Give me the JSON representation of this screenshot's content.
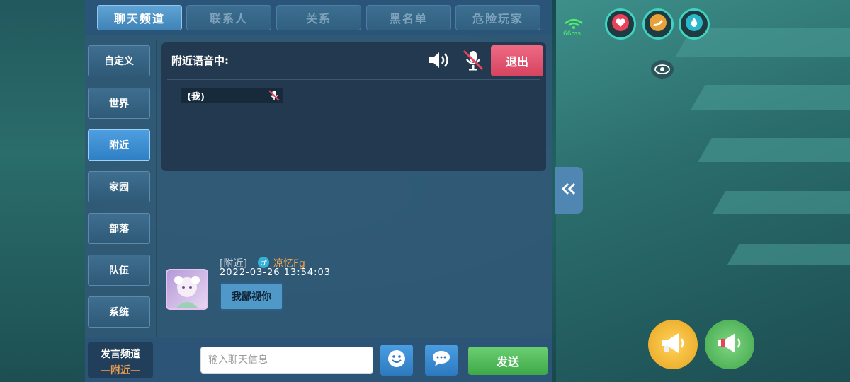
{
  "tabs": [
    {
      "label": "聊天频道",
      "active": true
    },
    {
      "label": "联系人",
      "active": false
    },
    {
      "label": "关系",
      "active": false
    },
    {
      "label": "黑名单",
      "active": false
    },
    {
      "label": "危险玩家",
      "active": false
    }
  ],
  "sidebar": {
    "items": [
      {
        "label": "自定义",
        "active": false
      },
      {
        "label": "世界",
        "active": false
      },
      {
        "label": "附近",
        "active": true
      },
      {
        "label": "家园",
        "active": false
      },
      {
        "label": "部落",
        "active": false
      },
      {
        "label": "队伍",
        "active": false
      },
      {
        "label": "系统",
        "active": false
      }
    ]
  },
  "voice": {
    "title": "附近语音中:",
    "exit_label": "退出",
    "member_label": "(我)"
  },
  "message": {
    "channel_tag": "[附近]",
    "gender_symbol": "♂",
    "sender": "凉忆Fg",
    "timestamp": "2022-03-26   13:54:03",
    "text": "我鄙视你"
  },
  "bottom": {
    "say_channel_label": "发言频道",
    "say_channel_value": "—附近—",
    "input_placeholder": "输入聊天信息",
    "send_label": "发送"
  },
  "hud": {
    "ping": "66ms",
    "stats": [
      "heart-icon",
      "stamina-icon",
      "water-icon"
    ]
  },
  "colors": {
    "active_tab": "#4f98d0",
    "exit_button": "#e05570",
    "send_button": "#4fb85a",
    "sender_name": "#e9a24f"
  }
}
